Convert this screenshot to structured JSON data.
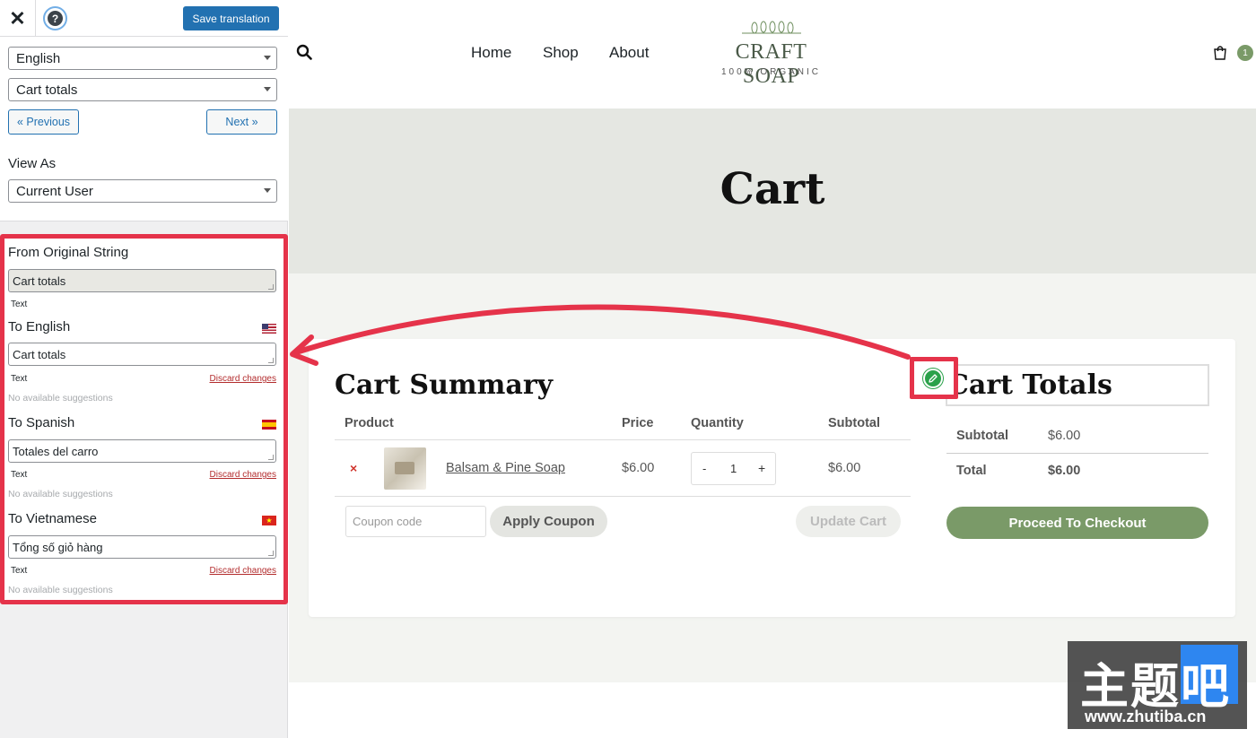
{
  "sidebar": {
    "save_label": "Save translation",
    "help_glyph": "?",
    "close_glyph": "✕",
    "language": "English",
    "string": "Cart totals",
    "prev_label": "« Previous",
    "next_label": "Next »",
    "view_as_label": "View As",
    "view_as_value": "Current User"
  },
  "translation": {
    "original_label": "From Original String",
    "original_value": "Cart totals",
    "type_label": "Text",
    "discard_label": "Discard changes",
    "no_suggestions": "No available suggestions",
    "languages": [
      {
        "label": "To English",
        "value": "Cart totals",
        "flag": "us-flag"
      },
      {
        "label": "To Spanish",
        "value": "Totales del carro",
        "flag": "es-flag"
      },
      {
        "label": "To Vietnamese",
        "value": "Tổng số giỏ hàng",
        "flag": "vn-flag"
      }
    ]
  },
  "site": {
    "nav": [
      "Home",
      "Shop",
      "About"
    ],
    "logo_name": "CRAFT SOAP",
    "logo_tagline": "100% ORGANIC",
    "cart_count": "1",
    "page_title": "Cart",
    "summary_title": "Cart Summary",
    "headers": {
      "product": "Product",
      "price": "Price",
      "quantity": "Quantity",
      "subtotal": "Subtotal"
    },
    "item": {
      "remove": "×",
      "name": "Balsam & Pine Soap",
      "price": "$6.00",
      "qty_minus": "-",
      "qty": "1",
      "qty_plus": "+",
      "subtotal": "$6.00"
    },
    "coupon_placeholder": "Coupon code",
    "apply_coupon": "Apply Coupon",
    "update_cart": "Update Cart",
    "totals_title": "Cart Totals",
    "subtotal_label": "Subtotal",
    "subtotal_value": "$6.00",
    "total_label": "Total",
    "total_value": "$6.00",
    "checkout_label": "Proceed To Checkout"
  },
  "watermark": {
    "text": "主题吧",
    "url": "www.zhutiba.cn"
  },
  "colors": {
    "accent_blue": "#2271b1",
    "highlight_red": "#e5334a",
    "brand_green": "#7a9a68",
    "edit_green": "#2aa14a"
  }
}
